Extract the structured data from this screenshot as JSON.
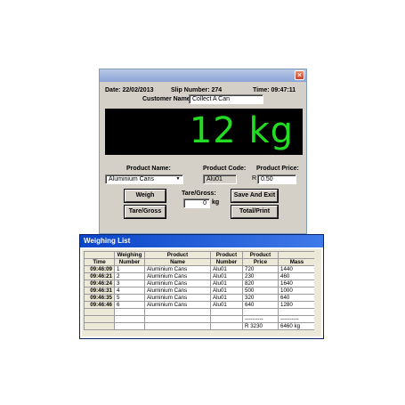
{
  "dialog": {
    "close_icon": "close-icon",
    "date": "Date: 22/02/2013",
    "slip": "Slip Number: 274",
    "time": "Time: 09:47:11",
    "customer_label": "Customer Name:",
    "customer_value": "Collect A Can",
    "display": "12 kg",
    "product_name_label": "Product Name:",
    "product_name_value": "Aluminium Cans",
    "product_code_label": "Product Code:",
    "product_code_value": "Alu01",
    "product_price_label": "Product Price:",
    "price_currency": "R",
    "product_price_value": "0.50",
    "tare_label": "Tare/Gross:",
    "tare_value": "0",
    "tare_unit": "kg",
    "weigh_button": "Weigh",
    "tare_gross_button": "Tare/Gross",
    "save_exit_button": "Save And Exit",
    "total_print_button": "Total/Print",
    "accent_color": "#22dd22"
  },
  "weighing_list": {
    "title": "Weighing List",
    "header_row1": [
      "",
      "Weighing",
      "Product",
      "Product",
      "Product",
      ""
    ],
    "header_row2": [
      "Time",
      "Number",
      "Name",
      "Number",
      "Price",
      "Mass"
    ],
    "rows": [
      [
        "09:46:09",
        "1",
        "Aluminium Cans",
        "Alu01",
        "720",
        "1440"
      ],
      [
        "09:46:21",
        "2",
        "Aluminium Cans",
        "Alu01",
        "230",
        "460"
      ],
      [
        "09:46:24",
        "3",
        "Aluminium Cans",
        "Alu01",
        "820",
        "1640"
      ],
      [
        "09:46:31",
        "4",
        "Aluminium Cans",
        "Alu01",
        "500",
        "1000"
      ],
      [
        "09:46:35",
        "5",
        "Aluminium Cans",
        "Alu01",
        "320",
        "640"
      ],
      [
        "09:46:46",
        "6",
        "Aluminium Cans",
        "Alu01",
        "640",
        "1280"
      ]
    ],
    "separator_price": "----------",
    "separator_mass": "----------",
    "total_price": "R 3230",
    "total_mass": "6460 kg"
  }
}
